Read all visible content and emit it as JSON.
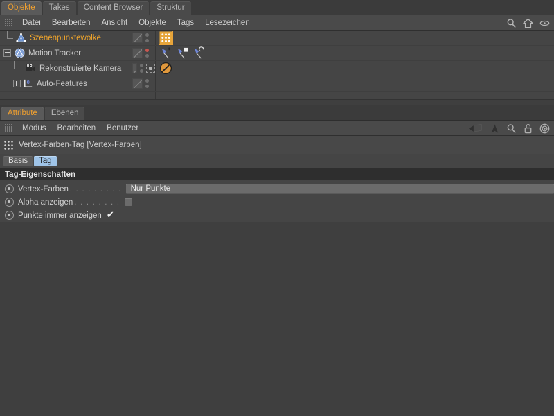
{
  "object_manager": {
    "tabs": [
      {
        "label": "Objekte",
        "active": true
      },
      {
        "label": "Takes",
        "active": false
      },
      {
        "label": "Content Browser",
        "active": false
      },
      {
        "label": "Struktur",
        "active": false
      }
    ],
    "menu": [
      "Datei",
      "Bearbeiten",
      "Ansicht",
      "Objekte",
      "Tags",
      "Lesezeichen"
    ],
    "toolbar_icons": [
      "search-icon",
      "home-icon",
      "eye-icon"
    ],
    "rows": [
      {
        "name": "Szenenpunktewolke",
        "icon": "point-cloud-icon",
        "selected": true,
        "depth": 1,
        "expander": "none",
        "dot_state": "normal",
        "extra_marker": "none",
        "tags": [
          "vertex-color-tag"
        ]
      },
      {
        "name": "Motion Tracker",
        "icon": "motion-tracker-icon",
        "selected": false,
        "depth": 0,
        "expander": "minus",
        "dot_state": "red",
        "extra_marker": "none",
        "tags": [
          "add-feature-tag",
          "manual-tracker-tag",
          "auto-tracker-tag"
        ]
      },
      {
        "name": "Rekonstruierte Kamera",
        "icon": "camera-icon",
        "selected": false,
        "depth": 2,
        "expander": "none",
        "dot_state": "normal",
        "extra_marker": "dashed-box",
        "tags": [
          "no-entry-tag"
        ]
      },
      {
        "name": "Auto-Features",
        "icon": "auto-features-icon",
        "selected": false,
        "depth": 1,
        "expander": "plus",
        "dot_state": "normal",
        "extra_marker": "none",
        "tags": []
      }
    ]
  },
  "attribute_manager": {
    "tabs": [
      {
        "label": "Attribute",
        "active": true
      },
      {
        "label": "Ebenen",
        "active": false
      }
    ],
    "menu": [
      "Modus",
      "Bearbeiten",
      "Benutzer"
    ],
    "toolbar_icons": [
      "back-arrow-icon",
      "up-arrow-icon",
      "search-icon",
      "lock-icon",
      "target-icon"
    ],
    "object_title": "Vertex-Farben-Tag [Vertex-Farben]",
    "object_icon": "vertex-color-tag-icon",
    "section_buttons": [
      {
        "label": "Basis",
        "active": false
      },
      {
        "label": "Tag",
        "active": true
      }
    ],
    "group_title": "Tag-Eigenschaften",
    "properties": [
      {
        "label": "Vertex-Farben",
        "dots": ". . . . . . . . .",
        "control": "combo",
        "value": "Nur Punkte"
      },
      {
        "label": "Alpha anzeigen",
        "dots": ". . . . . . . .",
        "control": "checkbox",
        "checked": false,
        "value": ""
      },
      {
        "label": "Punkte immer anzeigen",
        "dots": "",
        "control": "checkmark",
        "checked": true,
        "value": "✔"
      }
    ]
  },
  "colors": {
    "accent": "#f0a030",
    "panel": "#454545",
    "tab_active": "#5a5a5a",
    "group_bar": "#2e2e2e",
    "button_on": "#9fc4e8",
    "alert_dot": "#c9564f"
  }
}
